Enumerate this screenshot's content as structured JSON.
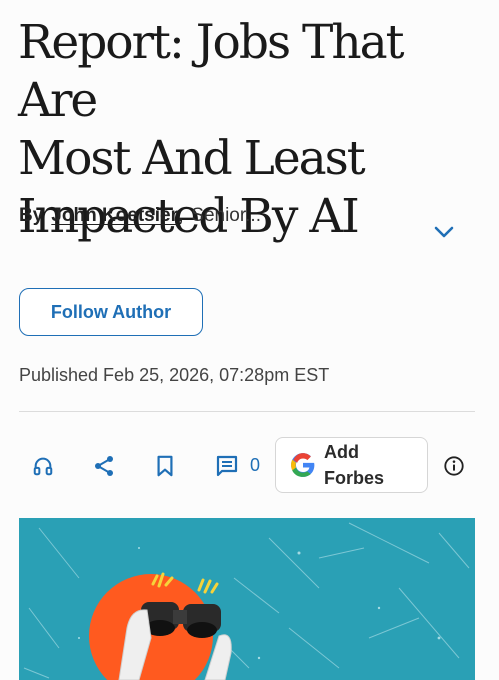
{
  "article": {
    "headline_lines": [
      "Report: Jobs That Are",
      "Most And Least",
      "Impacted By AI"
    ],
    "byline_prefix": "By",
    "author_name": "John Koetsier",
    "author_role": "Senior...",
    "follow_label": "Follow Author",
    "published": "Published Feb 25, 2026, 07:28pm EST"
  },
  "toolbar": {
    "listen_icon": "headphones-icon",
    "share_icon": "share-icon",
    "save_icon": "bookmark-icon",
    "comment_icon": "comment-icon",
    "comment_count": "0",
    "add_forbes_label": "Add Forbes",
    "info_icon": "info-icon"
  },
  "colors": {
    "accent": "#1f6fb6",
    "hero_bg": "#2aa0b5",
    "hero_circle": "#ff5a1f"
  }
}
